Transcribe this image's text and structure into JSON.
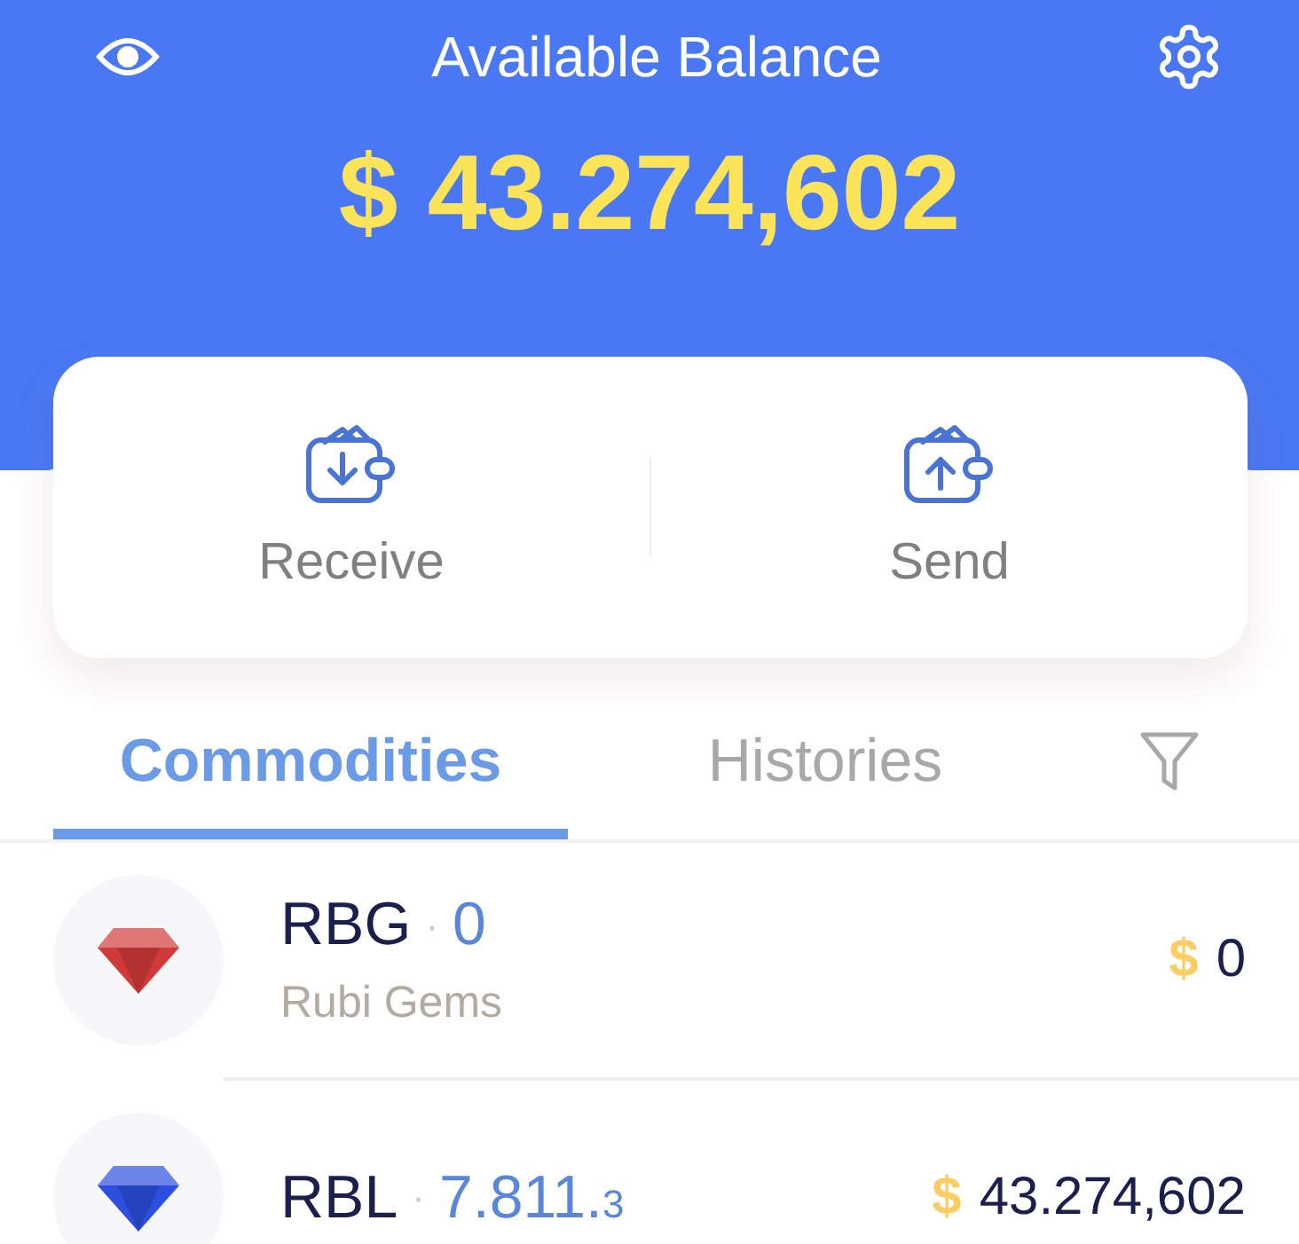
{
  "header": {
    "title": "Available Balance",
    "balance": "$ 43.274,602"
  },
  "actions": [
    {
      "kind": "receive",
      "label": "Receive"
    },
    {
      "kind": "send",
      "label": "Send"
    }
  ],
  "tabs": [
    {
      "label": "Commodities",
      "selected": true
    },
    {
      "label": "Histories",
      "selected": false
    }
  ],
  "assets": [
    {
      "color": "#d23a3a",
      "code": "RBG",
      "separator": "·",
      "amount": "0",
      "name": "Rubi Gems",
      "currency": "$",
      "value": "0"
    },
    {
      "color": "#2d4fe0",
      "code": "RBL",
      "separator": "·",
      "amount": "7.811.",
      "fraction": "3",
      "currency": "$",
      "value": "43.274,602"
    }
  ]
}
